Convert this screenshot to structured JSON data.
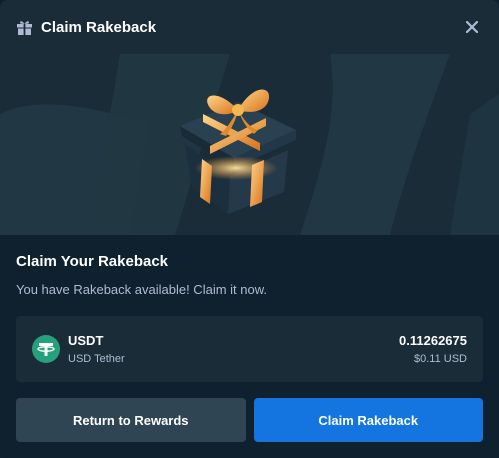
{
  "header": {
    "title": "Claim Rakeback",
    "icon": "gift-icon",
    "close_icon": "close-icon"
  },
  "banner": {
    "image": "gift-box-illustration"
  },
  "main": {
    "heading": "Claim Your Rakeback",
    "subtext": "You have Rakeback available! Claim it now."
  },
  "asset": {
    "icon": "tether-icon",
    "code": "USDT",
    "name": "USD Tether",
    "amount": "0.11262675",
    "usd_value": "$0.11 USD"
  },
  "actions": {
    "secondary_label": "Return to Rewards",
    "primary_label": "Claim Rakeback"
  },
  "colors": {
    "background": "#0f212e",
    "panel": "#1a2c38",
    "muted_text": "#b1bad3",
    "primary_button": "#1475e1",
    "secondary_button": "#2f4553",
    "tether": "#26a17b"
  }
}
